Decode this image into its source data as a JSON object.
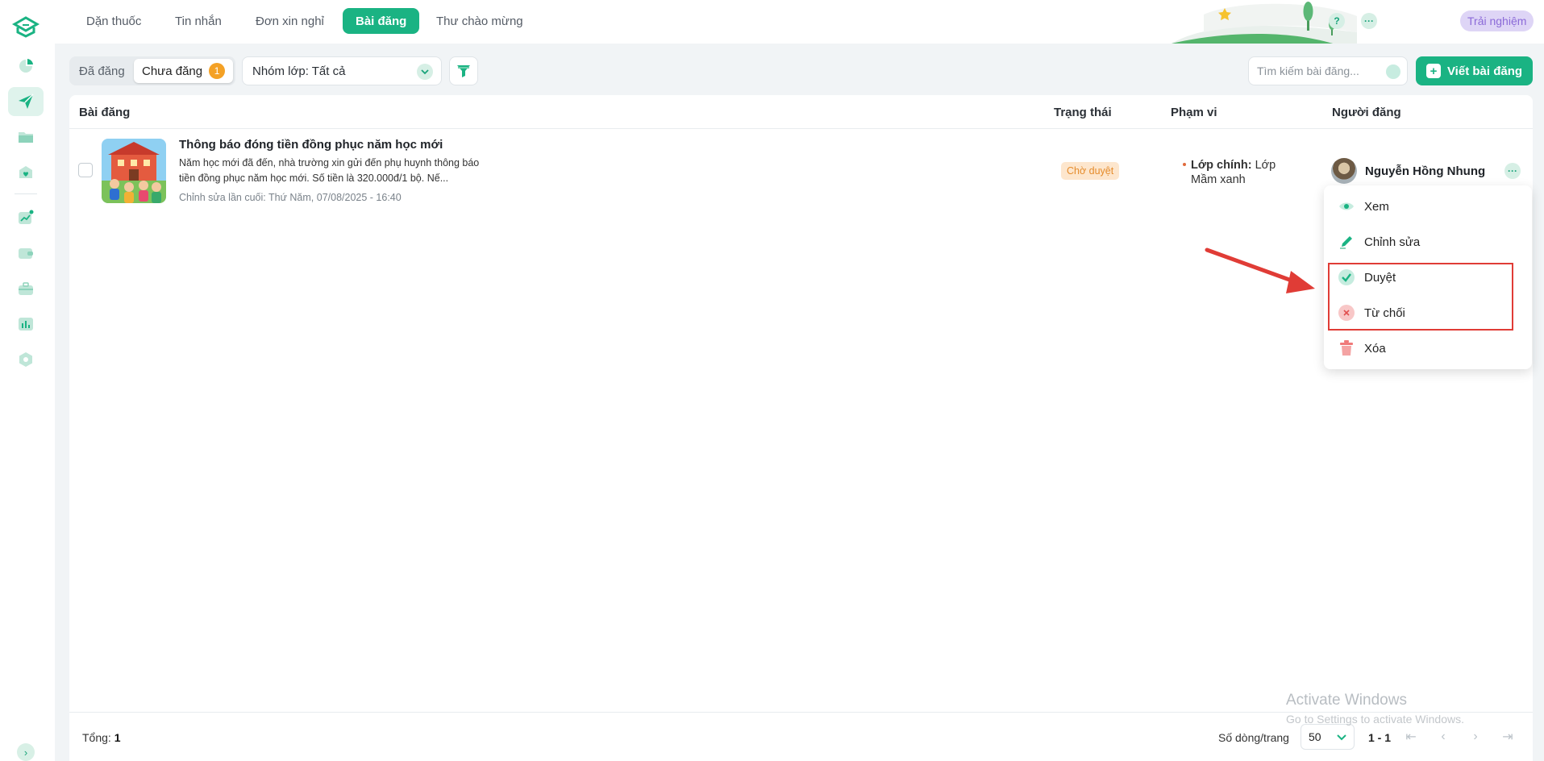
{
  "nav": {
    "tabs": [
      "Dặn thuốc",
      "Tin nhắn",
      "Đơn xin nghỉ",
      "Bài đăng",
      "Thư chào mừng"
    ],
    "active_tab": "Bài đăng",
    "help_icon": "?",
    "more_icon": "···",
    "trial_label": "Trải nghiệm"
  },
  "sidebar": {
    "icons": [
      "logo-icon",
      "dashboard-icon",
      "send-icon",
      "folder-icon",
      "heart-icon",
      "chart-line-icon",
      "wallet-icon",
      "briefcase-icon",
      "bar-chart-icon",
      "settings-icon"
    ],
    "active": "send-icon"
  },
  "toolbar": {
    "posted_label": "Đã đăng",
    "unposted_label": "Chưa đăng",
    "unposted_count": "1",
    "group_filter_label": "Nhóm lớp: Tất cả",
    "search_placeholder": "Tìm kiếm bài đăng...",
    "write_button_label": "Viết bài đăng"
  },
  "table": {
    "columns": {
      "post": "Bài đăng",
      "status": "Trạng thái",
      "scope": "Phạm vi",
      "poster": "Người đăng"
    },
    "rows": [
      {
        "title": "Thông báo đóng tiền đồng phục năm học mới",
        "description": "Năm học mới đã đến, nhà trường xin gửi đến phụ huynh thông báo tiền đồng phục năm học mới. Số tiền là 320.000đ/1 bộ. Nế...",
        "edited": "Chỉnh sửa lần cuối: Thứ Năm, 07/08/2025 - 16:40",
        "status": "Chờ duyệt",
        "scope_label": "Lớp chính:",
        "scope_value": "Lớp Mầm xanh",
        "poster": "Nguyễn Hồng Nhung"
      }
    ]
  },
  "menu": {
    "items": [
      "Xem",
      "Chỉnh sửa",
      "Duyệt",
      "Từ chối",
      "Xóa"
    ]
  },
  "footer": {
    "total_label": "Tổng:",
    "total_value": "1",
    "rows_per_page_label": "Số dòng/trang",
    "rows_per_page": "50",
    "range": "1 - 1"
  },
  "watermark": {
    "line1": "Activate Windows",
    "line2": "Go to Settings to activate Windows."
  },
  "colors": {
    "accent": "#1ab383",
    "status_pending": "#e58c2c",
    "highlight": "#e03c36"
  }
}
